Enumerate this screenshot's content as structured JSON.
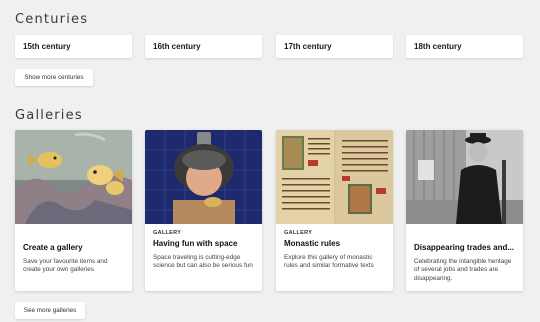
{
  "centuries": {
    "title": "Centuries",
    "items": [
      "15th century",
      "16th century",
      "17th century",
      "18th century"
    ],
    "more_label": "Show more centuries"
  },
  "galleries": {
    "title": "Galleries",
    "cards": [
      {
        "type": "",
        "title": "Create a gallery",
        "desc": "Save your favourite items and create your own galleries"
      },
      {
        "type": "GALLERY",
        "title": "Having fun with space",
        "desc": "Space traveling is cutting-edge science but can also be serious fun"
      },
      {
        "type": "GALLERY",
        "title": "Monastic rules",
        "desc": "Explore this gallery of monastic rules and similar formative texts"
      },
      {
        "type": "",
        "title": "Disappearing trades and...",
        "desc": "Celebrating the intangible heritage of several jobs and trades are disappearing."
      }
    ],
    "more_label": "See more galleries"
  }
}
